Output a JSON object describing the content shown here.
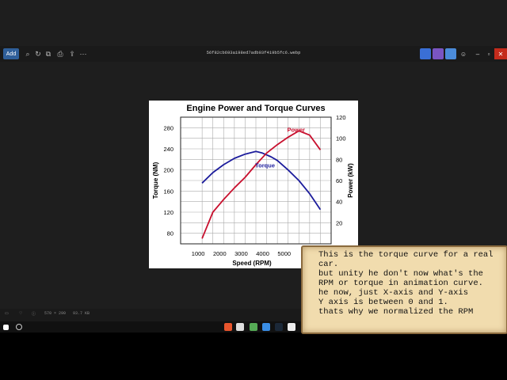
{
  "window": {
    "filename": "56f82cb693a198ed7adb93f419b5fc6.webp",
    "add_label": "Add",
    "image_size": "570 × 290",
    "file_size": "93.7 KB"
  },
  "chart_data": {
    "type": "line",
    "title": "Engine Power and Torque Curves",
    "xlabel": "Speed (RPM)",
    "ylabel_left": "Torque (NM)",
    "ylabel_right": "Power (kW)",
    "xlim": [
      0,
      7000
    ],
    "ylim_left": [
      60,
      300
    ],
    "ylim_right": [
      0,
      120
    ],
    "x_ticks": [
      "1000",
      "2000",
      "3000",
      "4000",
      "5000"
    ],
    "y_left_ticks": [
      "80",
      "120",
      "160",
      "200",
      "240",
      "280"
    ],
    "y_right_ticks": [
      "20",
      "40",
      "60",
      "80",
      "100",
      "120"
    ],
    "grid": true,
    "series": [
      {
        "name": "Torque",
        "axis": "left",
        "color": "#1c1c9c",
        "x": [
          1000,
          1500,
          2000,
          2500,
          3000,
          3500,
          3800,
          4200,
          4500,
          5000,
          5500,
          6000,
          6500
        ],
        "values": [
          175,
          195,
          210,
          222,
          230,
          235,
          232,
          225,
          218,
          200,
          180,
          155,
          125
        ]
      },
      {
        "name": "Power",
        "axis": "right",
        "color": "#c8102e",
        "x": [
          1000,
          1500,
          2000,
          2500,
          3000,
          3500,
          4000,
          4500,
          5000,
          5500,
          6000,
          6500
        ],
        "values": [
          5,
          30,
          42,
          53,
          63,
          75,
          86,
          94,
          101,
          107,
          103,
          89
        ]
      }
    ]
  },
  "note": {
    "lines": [
      "This is the torque curve for a real",
      "car.",
      "but unity he don't now what's the",
      "RPM or torque in animation curve.",
      "he now, just X-axis and Y-axis",
      "Y axis is between 0 and 1.",
      "thats why we normalized the RPM"
    ]
  },
  "colors": {
    "background": "#1e1e1e",
    "note_bg": "#f1dcae",
    "accent": "#2f5f9a"
  }
}
